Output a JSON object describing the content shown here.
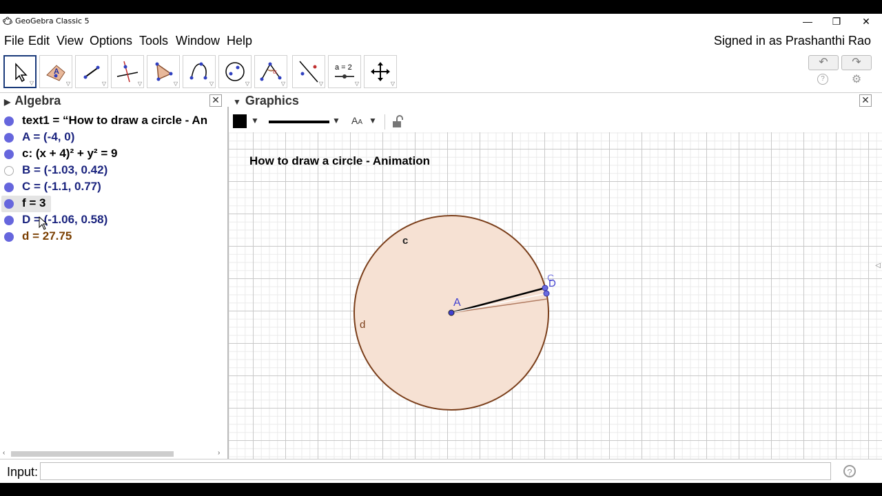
{
  "window": {
    "title": "GeoGebra Classic 5",
    "minimize": "—",
    "restore": "❐",
    "close": "✕"
  },
  "menu": [
    "File",
    "Edit",
    "View",
    "Options",
    "Tools",
    "Window",
    "Help"
  ],
  "signed_in": "Signed in as Prashanthi Rao",
  "toolbar": {
    "tools": [
      {
        "name": "move-tool",
        "active": true
      },
      {
        "name": "point-tool"
      },
      {
        "name": "line-tool"
      },
      {
        "name": "perpendicular-line-tool"
      },
      {
        "name": "polygon-tool"
      },
      {
        "name": "circle-center-point-tool"
      },
      {
        "name": "ellipse-tool"
      },
      {
        "name": "angle-tool"
      },
      {
        "name": "reflect-tool"
      },
      {
        "name": "slider-tool",
        "label": "a=2"
      },
      {
        "name": "move-graphics-tool"
      }
    ],
    "undo_icon": "↶",
    "redo_icon": "↷",
    "help_icon": "?",
    "settings_icon": "⚙"
  },
  "algebra": {
    "header": "Algebra",
    "items": [
      {
        "text": "text1 = “How to draw a circle - An",
        "color": "#000000",
        "dot": "#6666dd",
        "filled": true
      },
      {
        "text": "A = (-4, 0)",
        "color": "#1a237e",
        "dot": "#6666dd",
        "filled": true
      },
      {
        "text": "c: (x + 4)² + y² = 9",
        "color": "#000000",
        "dot": "#6666dd",
        "filled": true
      },
      {
        "text": "B = (-1.03, 0.42)",
        "color": "#1a237e",
        "dot": "#6666dd",
        "filled": false
      },
      {
        "text": "C = (-1.1, 0.77)",
        "color": "#1a237e",
        "dot": "#6666dd",
        "filled": true
      },
      {
        "text": "f = 3",
        "color": "#000000",
        "dot": "#6666dd",
        "filled": true,
        "selected": true
      },
      {
        "text": "D = (-1.06, 0.58)",
        "color": "#1a237e",
        "dot": "#6666dd",
        "filled": true
      },
      {
        "text": "d = 27.75",
        "color": "#7a3e00",
        "dot": "#6666dd",
        "filled": true
      }
    ]
  },
  "graphics": {
    "header": "Graphics",
    "title_text": "How to draw a circle - Animation",
    "labels": {
      "A": "A",
      "c": "c",
      "d": "d",
      "C": "C",
      "D": "D"
    },
    "colors": {
      "circle": "#7a3e1a",
      "fill": "#f6e1d3",
      "point": "#4040d0"
    }
  },
  "input": {
    "label": "Input:",
    "value": "",
    "help_icon": "?"
  },
  "colors": {
    "accent": "#1a3a7a"
  }
}
